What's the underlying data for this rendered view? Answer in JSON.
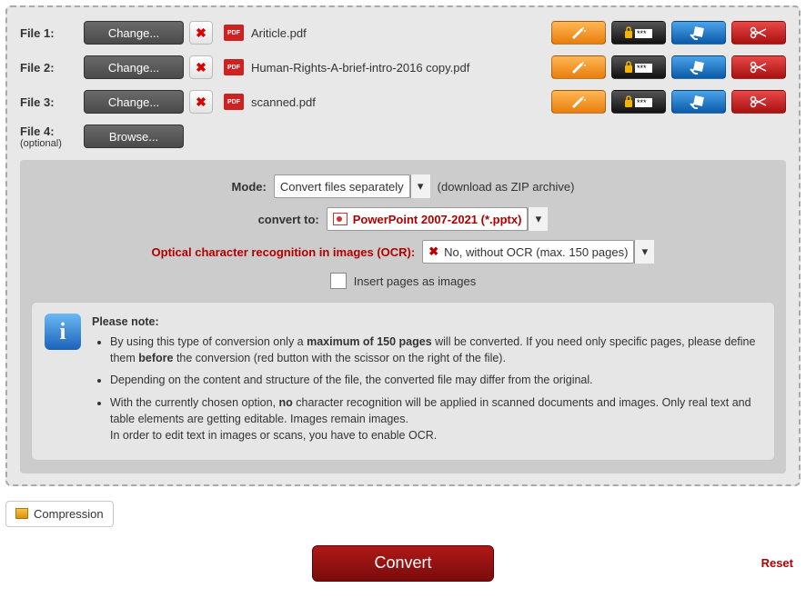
{
  "files": [
    {
      "label": "File 1:",
      "button": "Change...",
      "name": "Ariticle.pdf"
    },
    {
      "label": "File 2:",
      "button": "Change...",
      "name": "Human-Rights-A-brief-intro-2016 copy.pdf"
    },
    {
      "label": "File 3:",
      "button": "Change...",
      "name": "scanned.pdf"
    }
  ],
  "file4": {
    "label": "File 4:",
    "optional": "(optional)",
    "button": "Browse..."
  },
  "mode": {
    "label": "Mode:",
    "value": "Convert files separately",
    "hint": "(download as ZIP archive)"
  },
  "convert_to": {
    "label": "convert to:",
    "value": "PowerPoint 2007-2021 (*.pptx)"
  },
  "ocr": {
    "label": "Optical character recognition in images (OCR):",
    "value": "No, without OCR (max. 150 pages)"
  },
  "insert_images": "Insert pages as images",
  "note": {
    "title": "Please note:",
    "item1a": "By using this type of conversion only a ",
    "item1b": "maximum of 150 pages",
    "item1c": " will be converted. If you need only specific pages, please define them ",
    "item1d": "before",
    "item1e": " the conversion (red button with the scissor on the right of the file).",
    "item2": "Depending on the content and structure of the file, the converted file may differ from the original.",
    "item3a": "With the currently chosen option, ",
    "item3b": "no",
    "item3c": " character recognition will be applied in scanned documents and images. Only real text and table elements are getting editable. Images remain images.",
    "item3d": "In order to edit text in images or scans, you have to enable OCR."
  },
  "compression": "Compression",
  "convert": "Convert",
  "reset": "Reset"
}
